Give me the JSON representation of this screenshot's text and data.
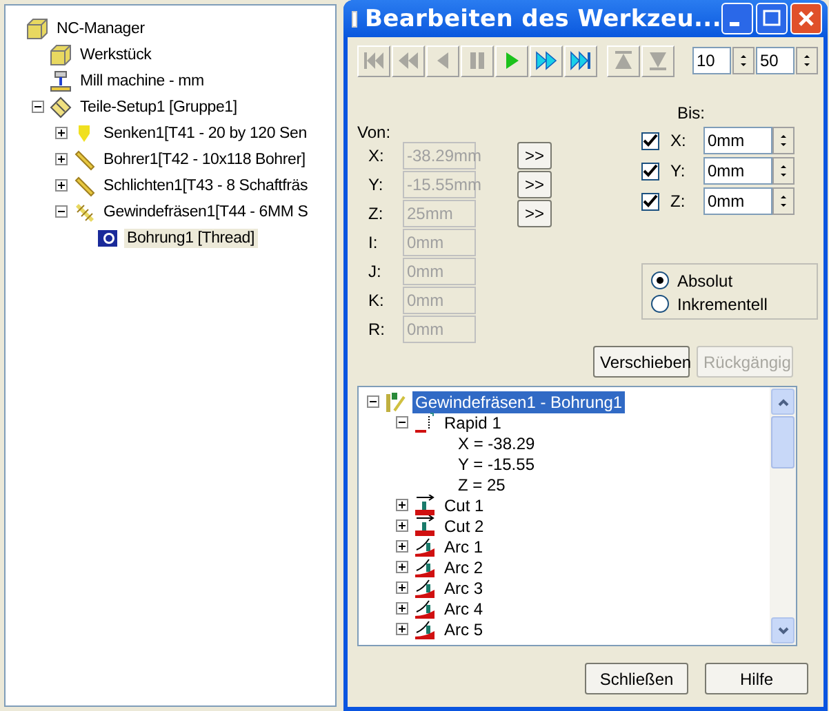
{
  "left_tree": {
    "items": [
      {
        "label": "NC-Manager",
        "kind": "box",
        "selected": false,
        "children": [
          {
            "label": "Werkstück",
            "kind": "box",
            "selected": false
          },
          {
            "label": "Mill machine - mm",
            "kind": "machine",
            "selected": false
          },
          {
            "label": "Teile-Setup1 [Gruppe1]",
            "kind": "setup",
            "selected": false,
            "expanded": true,
            "children": [
              {
                "label": "Senken1[T41 - 20 by 120 Sen",
                "kind": "countersink",
                "selected": false,
                "expanded": false
              },
              {
                "label": "Bohrer1[T42 - 10x118 Bohrer]",
                "kind": "drill",
                "selected": false,
                "expanded": false
              },
              {
                "label": "Schlichten1[T43 - 8 Schaftfräs",
                "kind": "drill",
                "selected": false,
                "expanded": false
              },
              {
                "label": "Gewindefräsen1[T44 - 6MM S",
                "kind": "thread",
                "selected": false,
                "expanded": true,
                "children": [
                  {
                    "label": "Bohrung1 [Thread]",
                    "kind": "hole",
                    "selected": true
                  }
                ]
              }
            ]
          }
        ]
      }
    ]
  },
  "dialog": {
    "title": "Bearbeiten des Werkzeu...",
    "toolbar": [
      {
        "kind": "first",
        "enabled": false
      },
      {
        "kind": "rewind",
        "enabled": false
      },
      {
        "kind": "back",
        "enabled": false
      },
      {
        "kind": "pause",
        "enabled": false
      },
      {
        "kind": "play",
        "enabled": true
      },
      {
        "kind": "forward",
        "enabled": true
      },
      {
        "kind": "last",
        "enabled": true
      },
      {
        "kind": "up",
        "enabled": false
      },
      {
        "kind": "down",
        "enabled": false
      }
    ],
    "spinners": [
      "10",
      "50"
    ],
    "von": {
      "label": "Von:",
      "fields": [
        {
          "label": "X:",
          "value": "-38.29mm",
          "disabled": true,
          "transfer": ">>"
        },
        {
          "label": "Y:",
          "value": "-15.55mm",
          "disabled": true,
          "transfer": ">>"
        },
        {
          "label": "Z:",
          "value": "25mm",
          "disabled": true,
          "transfer": ">>"
        },
        {
          "label": "I:",
          "value": "0mm",
          "disabled": true
        },
        {
          "label": "J:",
          "value": "0mm",
          "disabled": true
        },
        {
          "label": "K:",
          "value": "0mm",
          "disabled": true
        },
        {
          "label": "R:",
          "value": "0mm",
          "disabled": true
        }
      ]
    },
    "bis": {
      "label": "Bis:",
      "fields": [
        {
          "label": "X:",
          "value": "0mm",
          "checked": true
        },
        {
          "label": "Y:",
          "value": "0mm",
          "checked": true
        },
        {
          "label": "Z:",
          "value": "0mm",
          "checked": true
        }
      ]
    },
    "mode": [
      {
        "label": "Absolut",
        "selected": true
      },
      {
        "label": "Inkrementell",
        "selected": false
      }
    ],
    "actions": [
      {
        "label": "Verschieben",
        "disabled": false
      },
      {
        "label": "Rückgängig",
        "disabled": true
      }
    ],
    "path_tree": [
      {
        "label": "Gewindefräsen1 - Bohrung1",
        "kind": "operation",
        "selected": true,
        "expanded": true,
        "children": [
          {
            "label": "Rapid 1",
            "kind": "rapid",
            "selected": false,
            "expanded": true,
            "children": [
              {
                "label": "X = -38.29",
                "kind": "value",
                "selected": false
              },
              {
                "label": "Y = -15.55",
                "kind": "value",
                "selected": false
              },
              {
                "label": "Z = 25",
                "kind": "value",
                "selected": false
              }
            ]
          },
          {
            "label": "Cut 1",
            "kind": "cut",
            "selected": false,
            "expanded": false
          },
          {
            "label": "Cut 2",
            "kind": "cut",
            "selected": false,
            "expanded": false
          },
          {
            "label": "Arc 1",
            "kind": "arc",
            "selected": false,
            "expanded": false
          },
          {
            "label": "Arc 2",
            "kind": "arc",
            "selected": false,
            "expanded": false
          },
          {
            "label": "Arc 3",
            "kind": "arc",
            "selected": false,
            "expanded": false
          },
          {
            "label": "Arc 4",
            "kind": "arc",
            "selected": false,
            "expanded": false
          },
          {
            "label": "Arc 5",
            "kind": "arc",
            "selected": false,
            "expanded": false
          }
        ]
      }
    ],
    "footer": [
      "Schließen",
      "Hilfe"
    ]
  }
}
